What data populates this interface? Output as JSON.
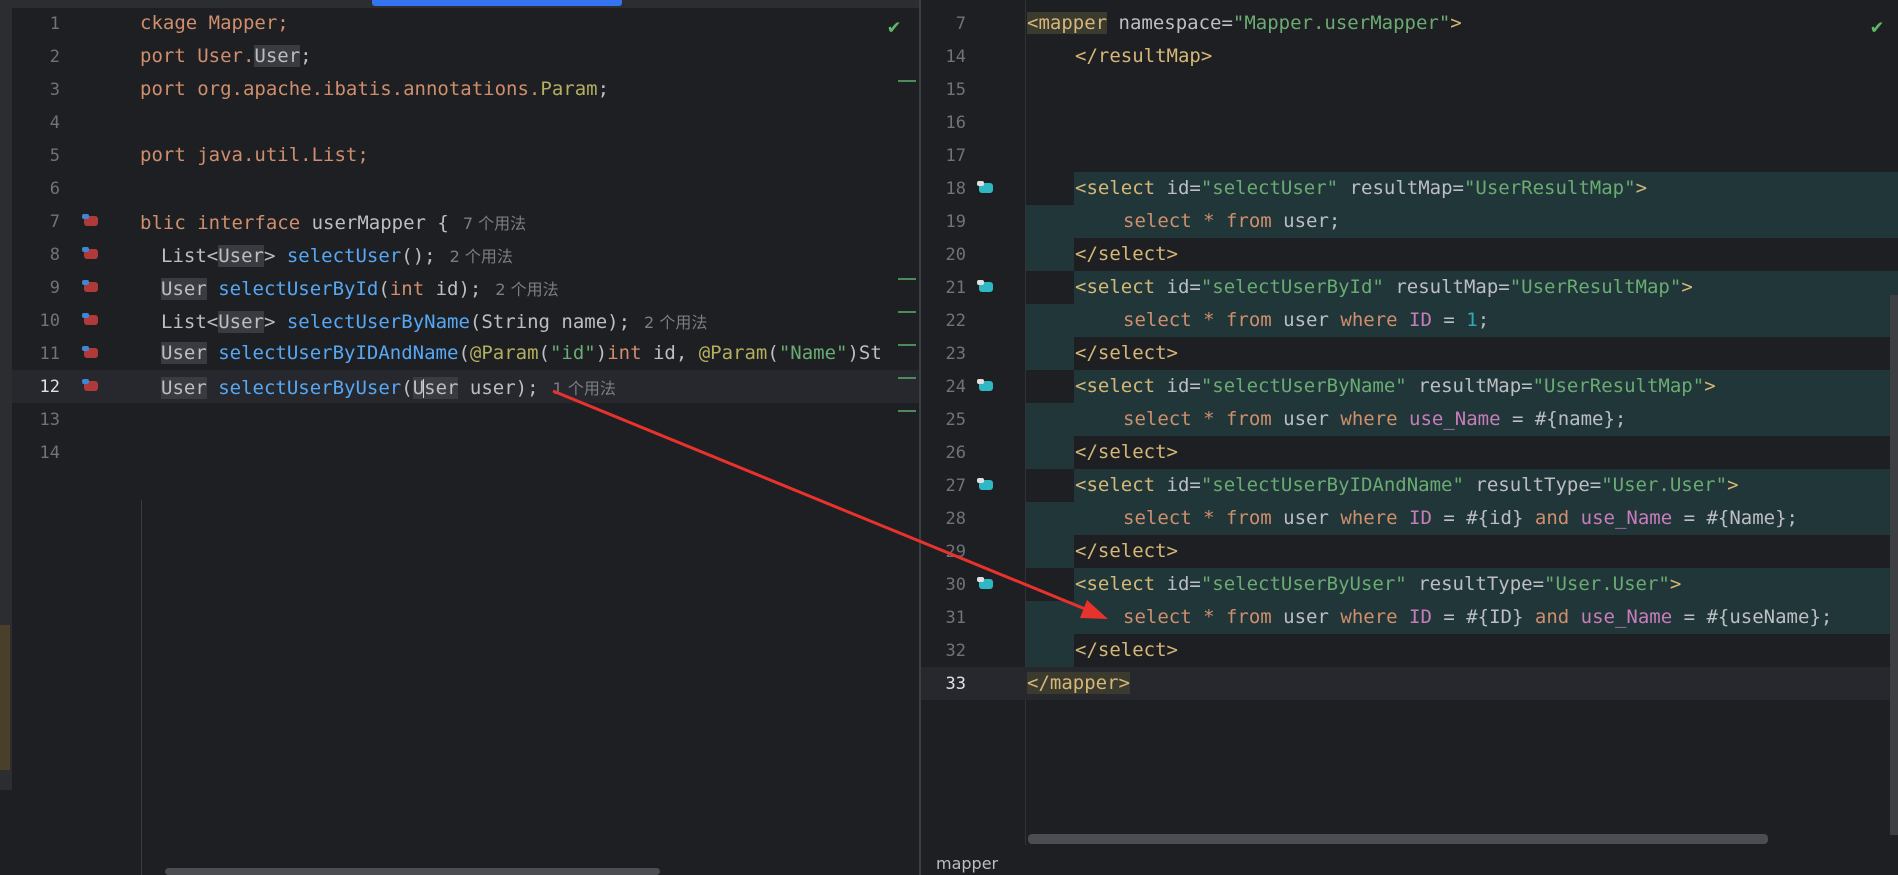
{
  "left_editor": {
    "lines": [
      {
        "num": "1",
        "code": [
          "package Mapper;"
        ]
      },
      {
        "num": "2"
      },
      {
        "num": "3"
      },
      {
        "num": "4"
      },
      {
        "num": "5"
      },
      {
        "num": "6"
      },
      {
        "num": "7"
      },
      {
        "num": "8"
      },
      {
        "num": "9"
      },
      {
        "num": "10"
      },
      {
        "num": "11"
      },
      {
        "num": "12"
      },
      {
        "num": "13"
      },
      {
        "num": "14"
      }
    ],
    "code": {
      "l1": "ckage Mapper;",
      "l2a": "port User.",
      "l2b": "User",
      "l2c": ";",
      "l3a": "port org.apache.ibatis.annotations.",
      "l3b": "Param",
      "l3c": ";",
      "l5": "port java.util.List;",
      "l7a": "blic ",
      "l7b": "interface",
      "l7c": " userMapper {",
      "l7hint": "7 个用法",
      "l8a": "List<",
      "l8b": "User",
      "l8c": "> ",
      "l8d": "selectUser",
      "l8e": "();",
      "l8hint": "2 个用法",
      "l9a": "User",
      "l9b": " ",
      "l9c": "selectUserById",
      "l9d": "(",
      "l9e": "int",
      "l9f": " id);",
      "l9hint": "2 个用法",
      "l10a": "List<",
      "l10b": "User",
      "l10c": "> ",
      "l10d": "selectUserByName",
      "l10e": "(String name);",
      "l10hint": "2 个用法",
      "l11a": "User",
      "l11b": " ",
      "l11c": "selectUserByIDAndName",
      "l11d": "(",
      "l11e": "@Param",
      "l11f": "(",
      "l11g": "\"id\"",
      "l11h": ")",
      "l11i": "int",
      "l11j": " id, ",
      "l11k": "@Param",
      "l11l": "(",
      "l11m": "\"Name\"",
      "l11n": ")St",
      "l12a": "User",
      "l12b": " ",
      "l12c": "selectUserByUser",
      "l12d": "(",
      "l12e1": "U",
      "l12e2": "ser",
      "l12f": " user);",
      "l12hint": "1 个用法"
    }
  },
  "right_editor": {
    "line_numbers": [
      "7",
      "14",
      "15",
      "16",
      "17",
      "18",
      "19",
      "20",
      "21",
      "22",
      "23",
      "24",
      "25",
      "26",
      "27",
      "28",
      "29",
      "30",
      "31",
      "32",
      "33"
    ],
    "code": {
      "r7a": "<mapper",
      "r7b": " namespace=",
      "r7c": "\"Mapper.userMapper\"",
      "r7d": ">",
      "r14": "</resultMap>",
      "r18a": "<select",
      "r18b": " id=",
      "r18c": "\"selectUser\"",
      "r18d": " resultMap=",
      "r18e": "\"UserResultMap\"",
      "r18f": ">",
      "r19a": "select",
      "r19b": " * ",
      "r19c": "from",
      "r19d": " user;",
      "r20": "</select>",
      "r21a": "<select",
      "r21b": " id=",
      "r21c": "\"selectUserById\"",
      "r21d": " resultMap=",
      "r21e": "\"UserResultMap\"",
      "r21f": ">",
      "r22a": "select",
      "r22b": " * ",
      "r22c": "from",
      "r22d": " user ",
      "r22e": "where",
      "r22f": " ",
      "r22g": "ID",
      "r22h": " = ",
      "r22i": "1",
      "r22j": ";",
      "r23": "</select>",
      "r24a": "<select",
      "r24b": " id=",
      "r24c": "\"selectUserByName\"",
      "r24d": " resultMap=",
      "r24e": "\"UserResultMap\"",
      "r24f": ">",
      "r25a": "select",
      "r25b": " * ",
      "r25c": "from",
      "r25d": " user ",
      "r25e": "where",
      "r25f": " ",
      "r25g": "use_Name",
      "r25h": " = #{name};",
      "r26": "</select>",
      "r27a": "<select",
      "r27b": " id=",
      "r27c": "\"selectUserByIDAndName\"",
      "r27d": " resultType=",
      "r27e": "\"User.User\"",
      "r27f": ">",
      "r28a": "select",
      "r28b": " * ",
      "r28c": "from",
      "r28d": " user ",
      "r28e": "where",
      "r28f": " ",
      "r28g": "ID",
      "r28h": " = #{id} ",
      "r28i": "and",
      "r28j": " ",
      "r28k": "use_Name",
      "r28l": " = #{Name};",
      "r29": "</select>",
      "r30a": "<select",
      "r30b": " id=",
      "r30c": "\"selectUserByUser\"",
      "r30d": " resultType=",
      "r30e": "\"User.User\"",
      "r30f": ">",
      "r31a": "select",
      "r31b": " * ",
      "r31c": "from",
      "r31d": " user ",
      "r31e": "where",
      "r31f": " ",
      "r31g": "ID",
      "r31h": " = #{ID} ",
      "r31i": "and",
      "r31j": " ",
      "r31k": "use_Name",
      "r31l": " = #{useName};",
      "r32": "</select>",
      "r33": "</mapper>"
    },
    "breadcrumb": "mapper"
  },
  "colors": {
    "background": "#1e1f22",
    "keyword": "#cf8e6d",
    "string": "#6aab73",
    "function": "#56a8f5",
    "annotation_arrow": "#e8322e"
  }
}
